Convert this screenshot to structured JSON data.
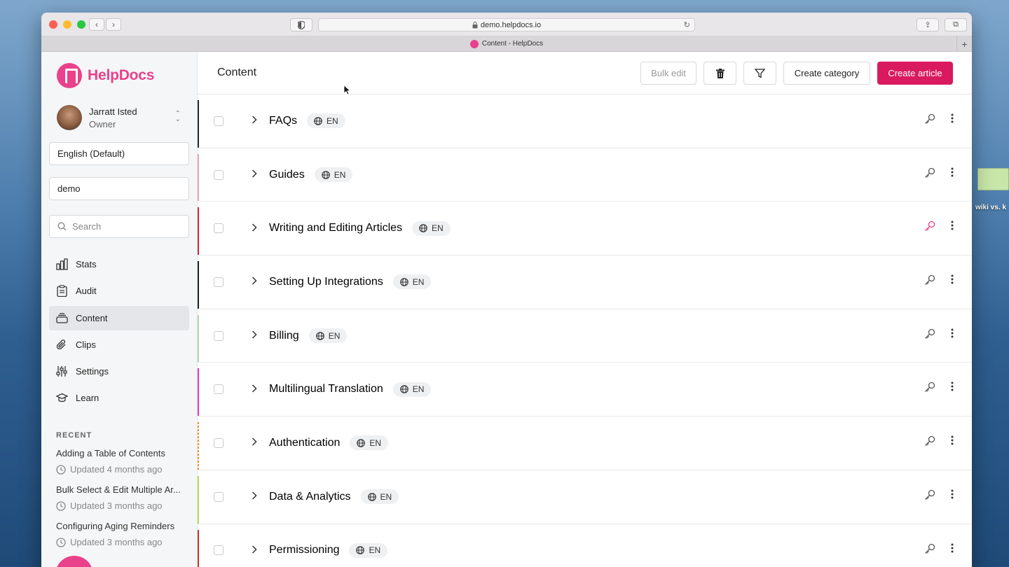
{
  "browser": {
    "url": "demo.helpdocs.io",
    "tab_title": "Content - HelpDocs"
  },
  "desktop": {
    "thumb_label": "wiki vs. k"
  },
  "sidebar": {
    "brand": "HelpDocs",
    "user": {
      "name": "Jarratt Isted",
      "role": "Owner"
    },
    "language": "English (Default)",
    "site": "demo",
    "search_placeholder": "Search",
    "nav": [
      {
        "label": "Stats",
        "icon": "bar-chart-icon"
      },
      {
        "label": "Audit",
        "icon": "clipboard-icon"
      },
      {
        "label": "Content",
        "icon": "stack-icon"
      },
      {
        "label": "Clips",
        "icon": "paperclip-icon"
      },
      {
        "label": "Settings",
        "icon": "sliders-icon"
      },
      {
        "label": "Learn",
        "icon": "graduation-cap-icon"
      }
    ],
    "recent_title": "RECENT",
    "recent": [
      {
        "title": "Adding a Table of Contents",
        "meta": "Updated 4 months ago"
      },
      {
        "title": "Bulk Select & Edit Multiple Ar...",
        "meta": "Updated 3 months ago"
      },
      {
        "title": "Configuring Aging Reminders",
        "meta": "Updated 3 months ago"
      }
    ]
  },
  "header": {
    "title": "Content",
    "bulk_edit": "Bulk edit",
    "create_category": "Create category",
    "create_article": "Create article"
  },
  "categories": [
    {
      "name": "FAQs",
      "lang": "EN",
      "color": "#1f2937"
    },
    {
      "name": "Guides",
      "lang": "EN",
      "color": "#e7a6b8"
    },
    {
      "name": "Writing and Editing Articles",
      "lang": "EN",
      "color": "#d7263d"
    },
    {
      "name": "Setting Up Integrations",
      "lang": "EN",
      "color": "#222222"
    },
    {
      "name": "Billing",
      "lang": "EN",
      "color": "#b5d6b2"
    },
    {
      "name": "Multilingual Translation",
      "lang": "EN",
      "color": "#d63bd1"
    },
    {
      "name": "Authentication",
      "lang": "EN",
      "color": "#f0932b"
    },
    {
      "name": "Data & Analytics",
      "lang": "EN",
      "color": "#b8d96a"
    },
    {
      "name": "Permissioning",
      "lang": "EN",
      "color": "#c0392b"
    }
  ],
  "colors": {
    "brand": "#e9418b",
    "primary_button": "#d91a5f",
    "highlight_key": "#e9418b"
  }
}
